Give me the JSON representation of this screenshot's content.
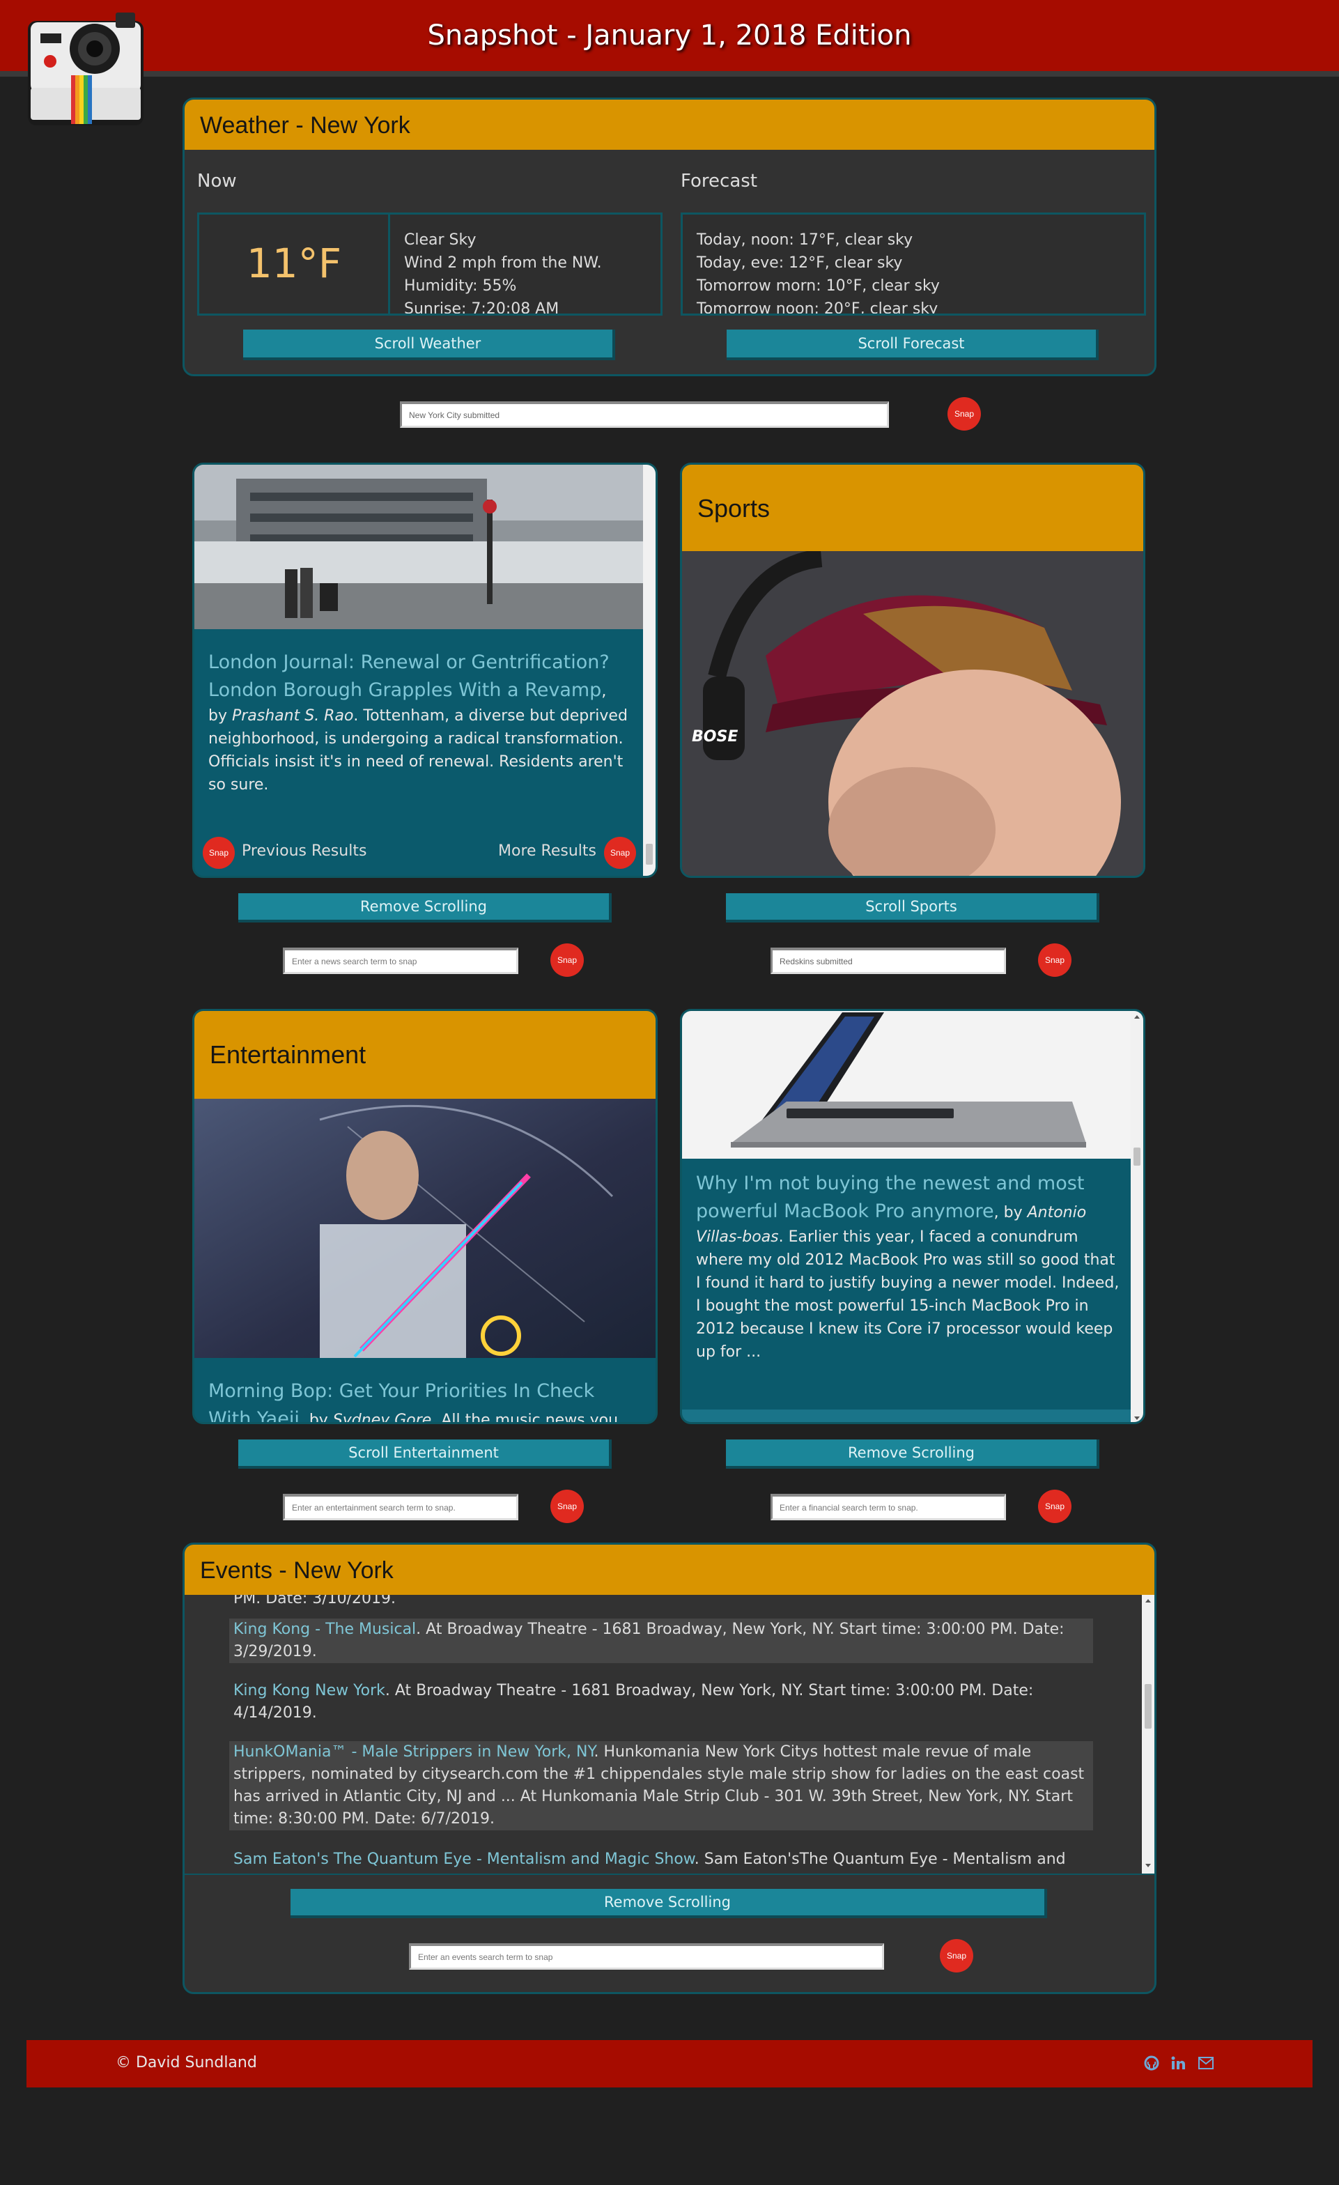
{
  "header": {
    "title": "Snapshot - January 1, 2018 Edition"
  },
  "weather": {
    "heading": "Weather - New York",
    "now_label": "Now",
    "forecast_label": "Forecast",
    "temp": "11°F",
    "details": [
      "Clear Sky",
      "Wind 2 mph from the NW.",
      "Humidity: 55%",
      "Sunrise: 7:20:08 AM"
    ],
    "forecast": [
      "Today, noon: 17°F, clear sky",
      "Today, eve: 12°F, clear sky",
      "Tomorrow morn: 10°F, clear sky",
      "Tomorrow noon: 20°F, clear sky"
    ],
    "scroll_weather": "Scroll Weather",
    "scroll_forecast": "Scroll Forecast",
    "input_value": "New York City submitted",
    "snap": "Snap"
  },
  "news": {
    "title": "London Journal: Renewal or Gentrification? London Borough Grapples With a Revamp",
    "by": ", by ",
    "author": "Prashant S. Rao",
    "summary": ". Tottenham, a diverse but deprived neighborhood, is undergoing a radical transformation. Officials insist it's in need of renewal. Residents aren't so sure.",
    "prev": "Previous Results",
    "more": "More Results",
    "snap": "Snap",
    "button": "Remove Scrolling",
    "placeholder": "Enter a news search term to snap"
  },
  "sports": {
    "heading": "Sports",
    "button": "Scroll Sports",
    "input_value": "Redskins submitted",
    "snap": "Snap",
    "cap_logo": "BOSE"
  },
  "entertainment": {
    "heading": "Entertainment",
    "title": "Morning Bop: Get Your Priorities In Check With Yaeji",
    "by": ", by ",
    "author": "Sydney Gore",
    "summary": ". All the music news you need to",
    "button": "Scroll Entertainment",
    "placeholder": "Enter an entertainment search term to snap.",
    "snap": "Snap"
  },
  "finance": {
    "title": "Why I'm not buying the newest and most powerful MacBook Pro anymore",
    "by": ", by ",
    "author": "Antonio Villas-boas",
    "summary": ". Earlier this year, I faced a conundrum where my old 2012 MacBook Pro was still so good that I found it hard to justify buying a newer model. Indeed, I bought the most powerful 15-inch MacBook Pro in 2012 because I knew its Core i7 processor would keep up for ...",
    "button": "Remove Scrolling",
    "placeholder": "Enter a financial search term to snap.",
    "snap": "Snap"
  },
  "events": {
    "heading": "Events - New York",
    "cut_top": "PM. Date: 3/10/2019.",
    "items": [
      {
        "link": "King Kong - The Musical",
        "text": ". At Broadway Theatre - 1681 Broadway, New York, NY. Start time: 3:00:00 PM. Date: 3/29/2019."
      },
      {
        "link": "King Kong New York",
        "text": ". At Broadway Theatre - 1681 Broadway, New York, NY. Start time: 3:00:00 PM. Date: 4/14/2019."
      },
      {
        "link": "HunkOMania™ - Male Strippers in New York, NY",
        "text": ". Hunkomania New York Citys hottest male revue of male strippers, nominated by citysearch.com the #1 chippendales style male strip show for ladies on the east coast has arrived in Atlantic City, NJ and ... At Hunkomania Male Strip Club - 301 W. 39th Street, New York, NY. Start time: 8:30:00 PM. Date: 6/7/2019."
      },
      {
        "link": "Sam Eaton's The Quantum Eye - Mentalism and Magic Show",
        "text": ". Sam Eaton'sThe Quantum Eye - Mentalism and"
      }
    ],
    "button": "Remove Scrolling",
    "placeholder": "Enter an events search term to snap",
    "snap": "Snap"
  },
  "footer": {
    "copyright": "© David Sundland"
  }
}
